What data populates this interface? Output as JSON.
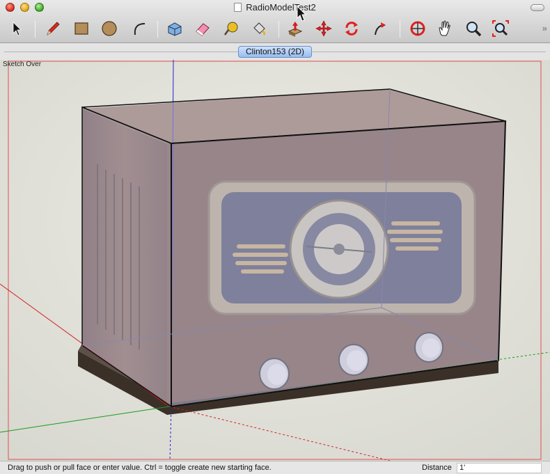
{
  "window": {
    "title": "RadioModelTest2"
  },
  "toolbar": {
    "tools": [
      {
        "name": "Select",
        "icon": "select-arrow-icon"
      },
      {
        "name": "Line",
        "icon": "pencil-icon"
      },
      {
        "name": "Rectangle",
        "icon": "rectangle-icon"
      },
      {
        "name": "Circle",
        "icon": "circle-icon"
      },
      {
        "name": "Arc",
        "icon": "arc-icon"
      },
      {
        "name": "Make Component",
        "icon": "component-icon"
      },
      {
        "name": "Eraser",
        "icon": "eraser-icon"
      },
      {
        "name": "Tape Measure",
        "icon": "tape-measure-icon"
      },
      {
        "name": "Paint Bucket",
        "icon": "paint-bucket-icon"
      },
      {
        "name": "Push/Pull",
        "icon": "push-pull-icon"
      },
      {
        "name": "Move",
        "icon": "move-icon"
      },
      {
        "name": "Rotate",
        "icon": "rotate-icon"
      },
      {
        "name": "Follow Me",
        "icon": "follow-me-icon"
      },
      {
        "name": "Orbit",
        "icon": "orbit-icon"
      },
      {
        "name": "Pan",
        "icon": "pan-hand-icon"
      },
      {
        "name": "Zoom",
        "icon": "zoom-icon"
      },
      {
        "name": "Zoom Extents",
        "icon": "zoom-extents-icon"
      }
    ],
    "overflow_glyph": "»"
  },
  "scene_tab": {
    "label": "Clinton153 (2D)"
  },
  "viewport": {
    "style_label": "Sketch Over"
  },
  "status": {
    "hint": "Drag to push or pull face or enter value.  Ctrl = toggle create new starting face.",
    "vcb_label": "Distance",
    "vcb_value": "1'"
  },
  "colors": {
    "toolbar_bg": "#d4d4d4",
    "scene_tab_accent": "#97bdf0",
    "red_axis": "#d42020",
    "green_axis": "#1a9a1a",
    "blue_axis": "#2020d0"
  }
}
